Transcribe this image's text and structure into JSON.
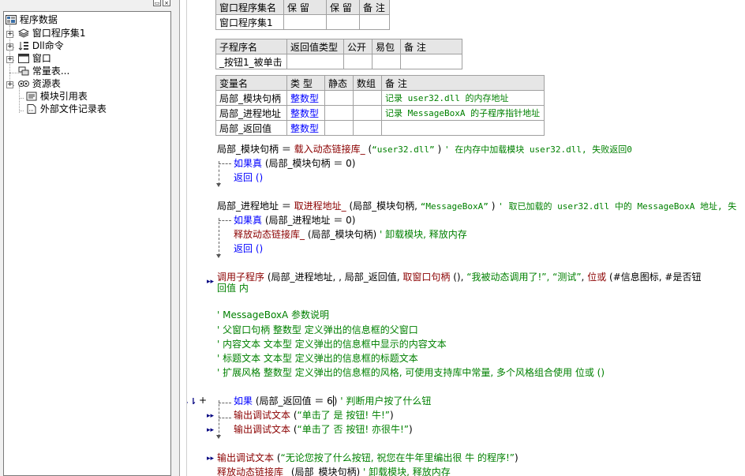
{
  "tree": {
    "root": "程序数据",
    "items": [
      {
        "label": "窗口程序集1",
        "icon": "layers-icon",
        "expandable": true
      },
      {
        "label": "Dll命令",
        "icon": "dll-icon",
        "expandable": true
      },
      {
        "label": "窗口",
        "icon": "window-icon",
        "expandable": true
      },
      {
        "label": "常量表...",
        "icon": "constant-icon",
        "expandable": false
      },
      {
        "label": "资源表",
        "icon": "resource-icon",
        "expandable": true
      },
      {
        "label": "模块引用表",
        "icon": "module-icon",
        "expandable": false
      },
      {
        "label": "外部文件记录表",
        "icon": "file-icon",
        "expandable": false
      }
    ]
  },
  "assembly_table": {
    "headers": [
      "窗口程序集名",
      "保 留",
      "保 留",
      "备 注"
    ],
    "row": [
      "窗口程序集1",
      "",
      "",
      ""
    ]
  },
  "sub_table": {
    "headers": [
      "子程序名",
      "返回值类型",
      "公开",
      "易包",
      "备 注"
    ],
    "row": [
      "_按钮1_被单击",
      "",
      "",
      "",
      ""
    ]
  },
  "var_table": {
    "headers": [
      "变量名",
      "类 型",
      "静态",
      "数组",
      "备 注"
    ],
    "rows": [
      [
        "局部_模块句柄",
        "整数型",
        "",
        "",
        "记录 user32.dll 的内存地址"
      ],
      [
        "局部_进程地址",
        "整数型",
        "",
        "",
        "记录 MessageBoxA 的子程序指针地址"
      ],
      [
        "局部_返回值",
        "整数型",
        "",
        "",
        ""
      ]
    ]
  },
  "code": {
    "l1a": "局部_模块句柄 ＝ ",
    "l1b": "载入动态链接库_",
    "l1c": " (",
    "l1d": "“user32.dll”",
    "l1e": " ) ",
    "l1f": "' 在内存中加载模块 user32.dll, 失败返回0",
    "l2a": "如果真",
    "l2b": " (局部_模块句柄 ＝ 0)",
    "l3": "返回 ()",
    "l4a": "局部_进程地址 ＝ ",
    "l4b": "取进程地址_",
    "l4c": " (局部_模块句柄, ",
    "l4d": "“MessageBoxA”",
    "l4e": " ) ",
    "l4f": "' 取已加载的 user32.dll 中的 MessageBoxA 地址, 失",
    "l5a": "如果真",
    "l5b": " (局部_进程地址 ＝ 0)",
    "l6a": "释放动态链接库_",
    "l6b": " (局部_模块句柄) ",
    "l6c": "' 卸载模块, 释放内存",
    "l7": "返回 ()",
    "l8a": "调用子程序",
    "l8b": " (局部_进程地址, , 局部_返回值, ",
    "l8c": "取窗口句柄",
    "l8d": " (), ",
    "l8e": "“我被动态调用了!”, “测试”",
    "l8f": ", ",
    "l8g": "位或",
    "l8h": " (#信息图标, #是否钮",
    "l9": "回值 内",
    "c1": "' MessageBoxA 参数说明",
    "c2": "' 父窗口句柄  整数型  定义弹出的信息框的父窗口",
    "c3": "' 内容文本    文本型  定义弹出的信息框中显示的内容文本",
    "c4": "' 标题文本    文本型  定义弹出的信息框的标题文本",
    "c5": "' 扩展风格    整数型  定义弹出的信息框的风格, 可使用支持库中常量, 多个风格组合使用 位或 ()",
    "l10a": "如果",
    "l10b": " (局部_返回值 ＝ 6",
    "l10c": ")",
    "l10d": "' 判断用户按了什么钮",
    "l11a": "输出调试文本",
    "l11b": " (",
    "l11c": "“单击了 是 按钮! 牛!”",
    "l11d": ")",
    "l12a": "输出调试文本",
    "l12b": " (",
    "l12c": "“单击了 否 按钮! 亦很牛!”",
    "l12d": ")",
    "l13a": "输出调试文本",
    "l13b": " (",
    "l13c": "“无论您按了什么按钮, 祝您在牛年里编出很 牛 的程序!”",
    "l13d": ")",
    "l14a": "释放动态链接库_",
    "l14b": " (局部_模块句柄) ",
    "l14c": "' 卸载模块, 释放内存",
    "plus": "+"
  }
}
